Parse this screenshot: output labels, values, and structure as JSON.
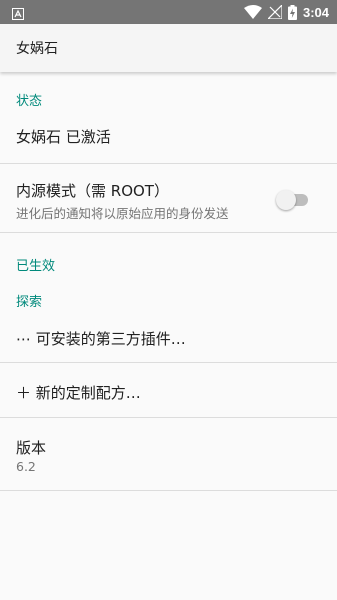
{
  "status_bar": {
    "time": "3:04",
    "left_icon": "notification-icon",
    "icons": [
      "wifi-icon",
      "signal-off-icon",
      "battery-charging-icon"
    ]
  },
  "app_bar": {
    "title": "女娲石"
  },
  "sections": {
    "status": {
      "header": "状态",
      "activated": "女娲石 已激活"
    },
    "mode": {
      "title": "内源模式（需 ROOT）",
      "summary": "进化后的通知将以原始应用的身份发送",
      "enabled": false
    },
    "effective": {
      "header": "已生效"
    },
    "explore": {
      "header": "探索",
      "plugins": "⋯ 可安装的第三方插件…"
    },
    "new_recipe": "＋ 新的定制配方…",
    "version": {
      "title": "版本",
      "value": "6.2"
    }
  },
  "colors": {
    "accent": "#00897b",
    "status_bar": "#757575",
    "background": "#fafafa"
  }
}
